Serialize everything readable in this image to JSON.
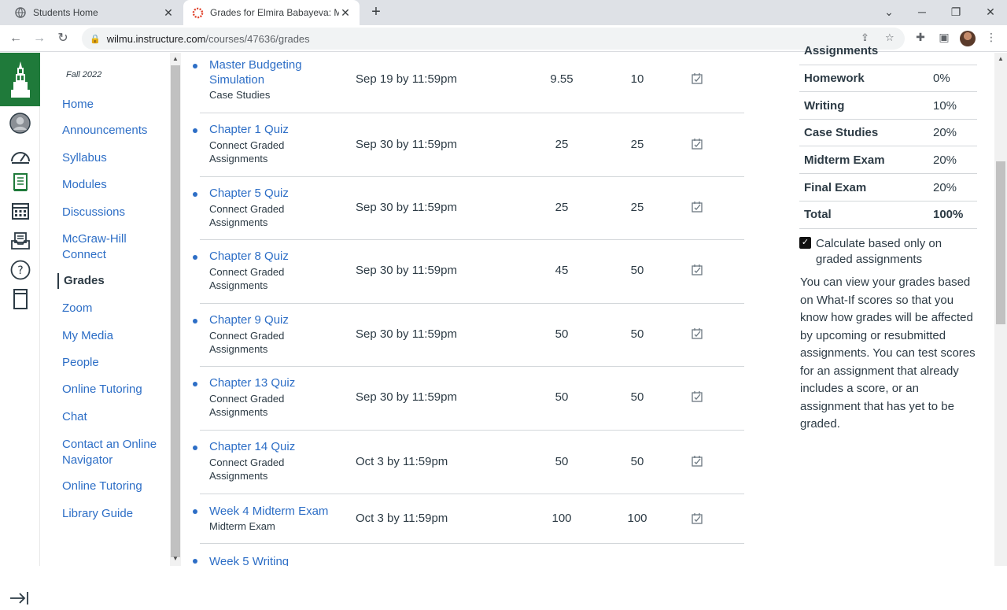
{
  "browser": {
    "tabs": [
      {
        "title": "Students Home",
        "favicon": "globe-icon"
      },
      {
        "title": "Grades for Elmira Babayeva: Man",
        "favicon": "canvas-icon"
      }
    ],
    "url_host": "wilmu.instructure.com",
    "url_path": "/courses/47636/grades"
  },
  "global_nav": {
    "items": [
      "account-icon",
      "dashboard-icon",
      "courses-icon",
      "calendar-icon",
      "inbox-icon",
      "help-icon",
      "tablet-icon"
    ],
    "accent": "#1f7a3a"
  },
  "course_nav": {
    "term": "Fall 2022",
    "items": [
      {
        "label": "Home"
      },
      {
        "label": "Announcements"
      },
      {
        "label": "Syllabus"
      },
      {
        "label": "Modules"
      },
      {
        "label": "Discussions"
      },
      {
        "label": "McGraw-Hill Connect"
      },
      {
        "label": "Grades"
      },
      {
        "label": "Zoom"
      },
      {
        "label": "My Media"
      },
      {
        "label": "People"
      },
      {
        "label": "Online Tutoring"
      },
      {
        "label": "Chat"
      },
      {
        "label": "Contact an Online Navigator"
      },
      {
        "label": "Online Tutoring"
      },
      {
        "label": "Library Guide"
      }
    ]
  },
  "assignments": [
    {
      "name": "Master Budgeting Simulation",
      "group": "Case Studies",
      "due": "Sep 19 by 11:59pm",
      "score": "9.55",
      "out_of": "10"
    },
    {
      "name": "Chapter 1 Quiz",
      "group": "Connect Graded Assignments",
      "due": "Sep 30 by 11:59pm",
      "score": "25",
      "out_of": "25"
    },
    {
      "name": "Chapter 5 Quiz",
      "group": "Connect Graded Assignments",
      "due": "Sep 30 by 11:59pm",
      "score": "25",
      "out_of": "25"
    },
    {
      "name": "Chapter 8 Quiz",
      "group": "Connect Graded Assignments",
      "due": "Sep 30 by 11:59pm",
      "score": "45",
      "out_of": "50"
    },
    {
      "name": "Chapter 9 Quiz",
      "group": "Connect Graded Assignments",
      "due": "Sep 30 by 11:59pm",
      "score": "50",
      "out_of": "50"
    },
    {
      "name": "Chapter 13 Quiz",
      "group": "Connect Graded Assignments",
      "due": "Sep 30 by 11:59pm",
      "score": "50",
      "out_of": "50"
    },
    {
      "name": "Chapter 14 Quiz",
      "group": "Connect Graded Assignments",
      "due": "Oct 3 by 11:59pm",
      "score": "50",
      "out_of": "50"
    },
    {
      "name": "Week 4 Midterm Exam",
      "group": "Midterm Exam",
      "due": "Oct 3 by 11:59pm",
      "score": "100",
      "out_of": "100"
    },
    {
      "name": "Week 5 Writing",
      "group": "",
      "due": "",
      "score": "",
      "out_of": ""
    }
  ],
  "weights": {
    "header_partial": "Assignments",
    "rows": [
      {
        "group": "Homework",
        "weight": "0%"
      },
      {
        "group": "Writing",
        "weight": "10%"
      },
      {
        "group": "Case Studies",
        "weight": "20%"
      },
      {
        "group": "Midterm Exam",
        "weight": "20%"
      },
      {
        "group": "Final Exam",
        "weight": "20%"
      },
      {
        "group": "Total",
        "weight": "100%"
      }
    ],
    "calc_checkbox_label": "Calculate based only on graded assignments",
    "calc_checked": true,
    "whatif_text": "You can view your grades based on What-If scores so that you know how grades will be affected by upcoming or resubmitted assignments. You can test scores for an assignment that already includes a score, or an assignment that has yet to be graded."
  }
}
